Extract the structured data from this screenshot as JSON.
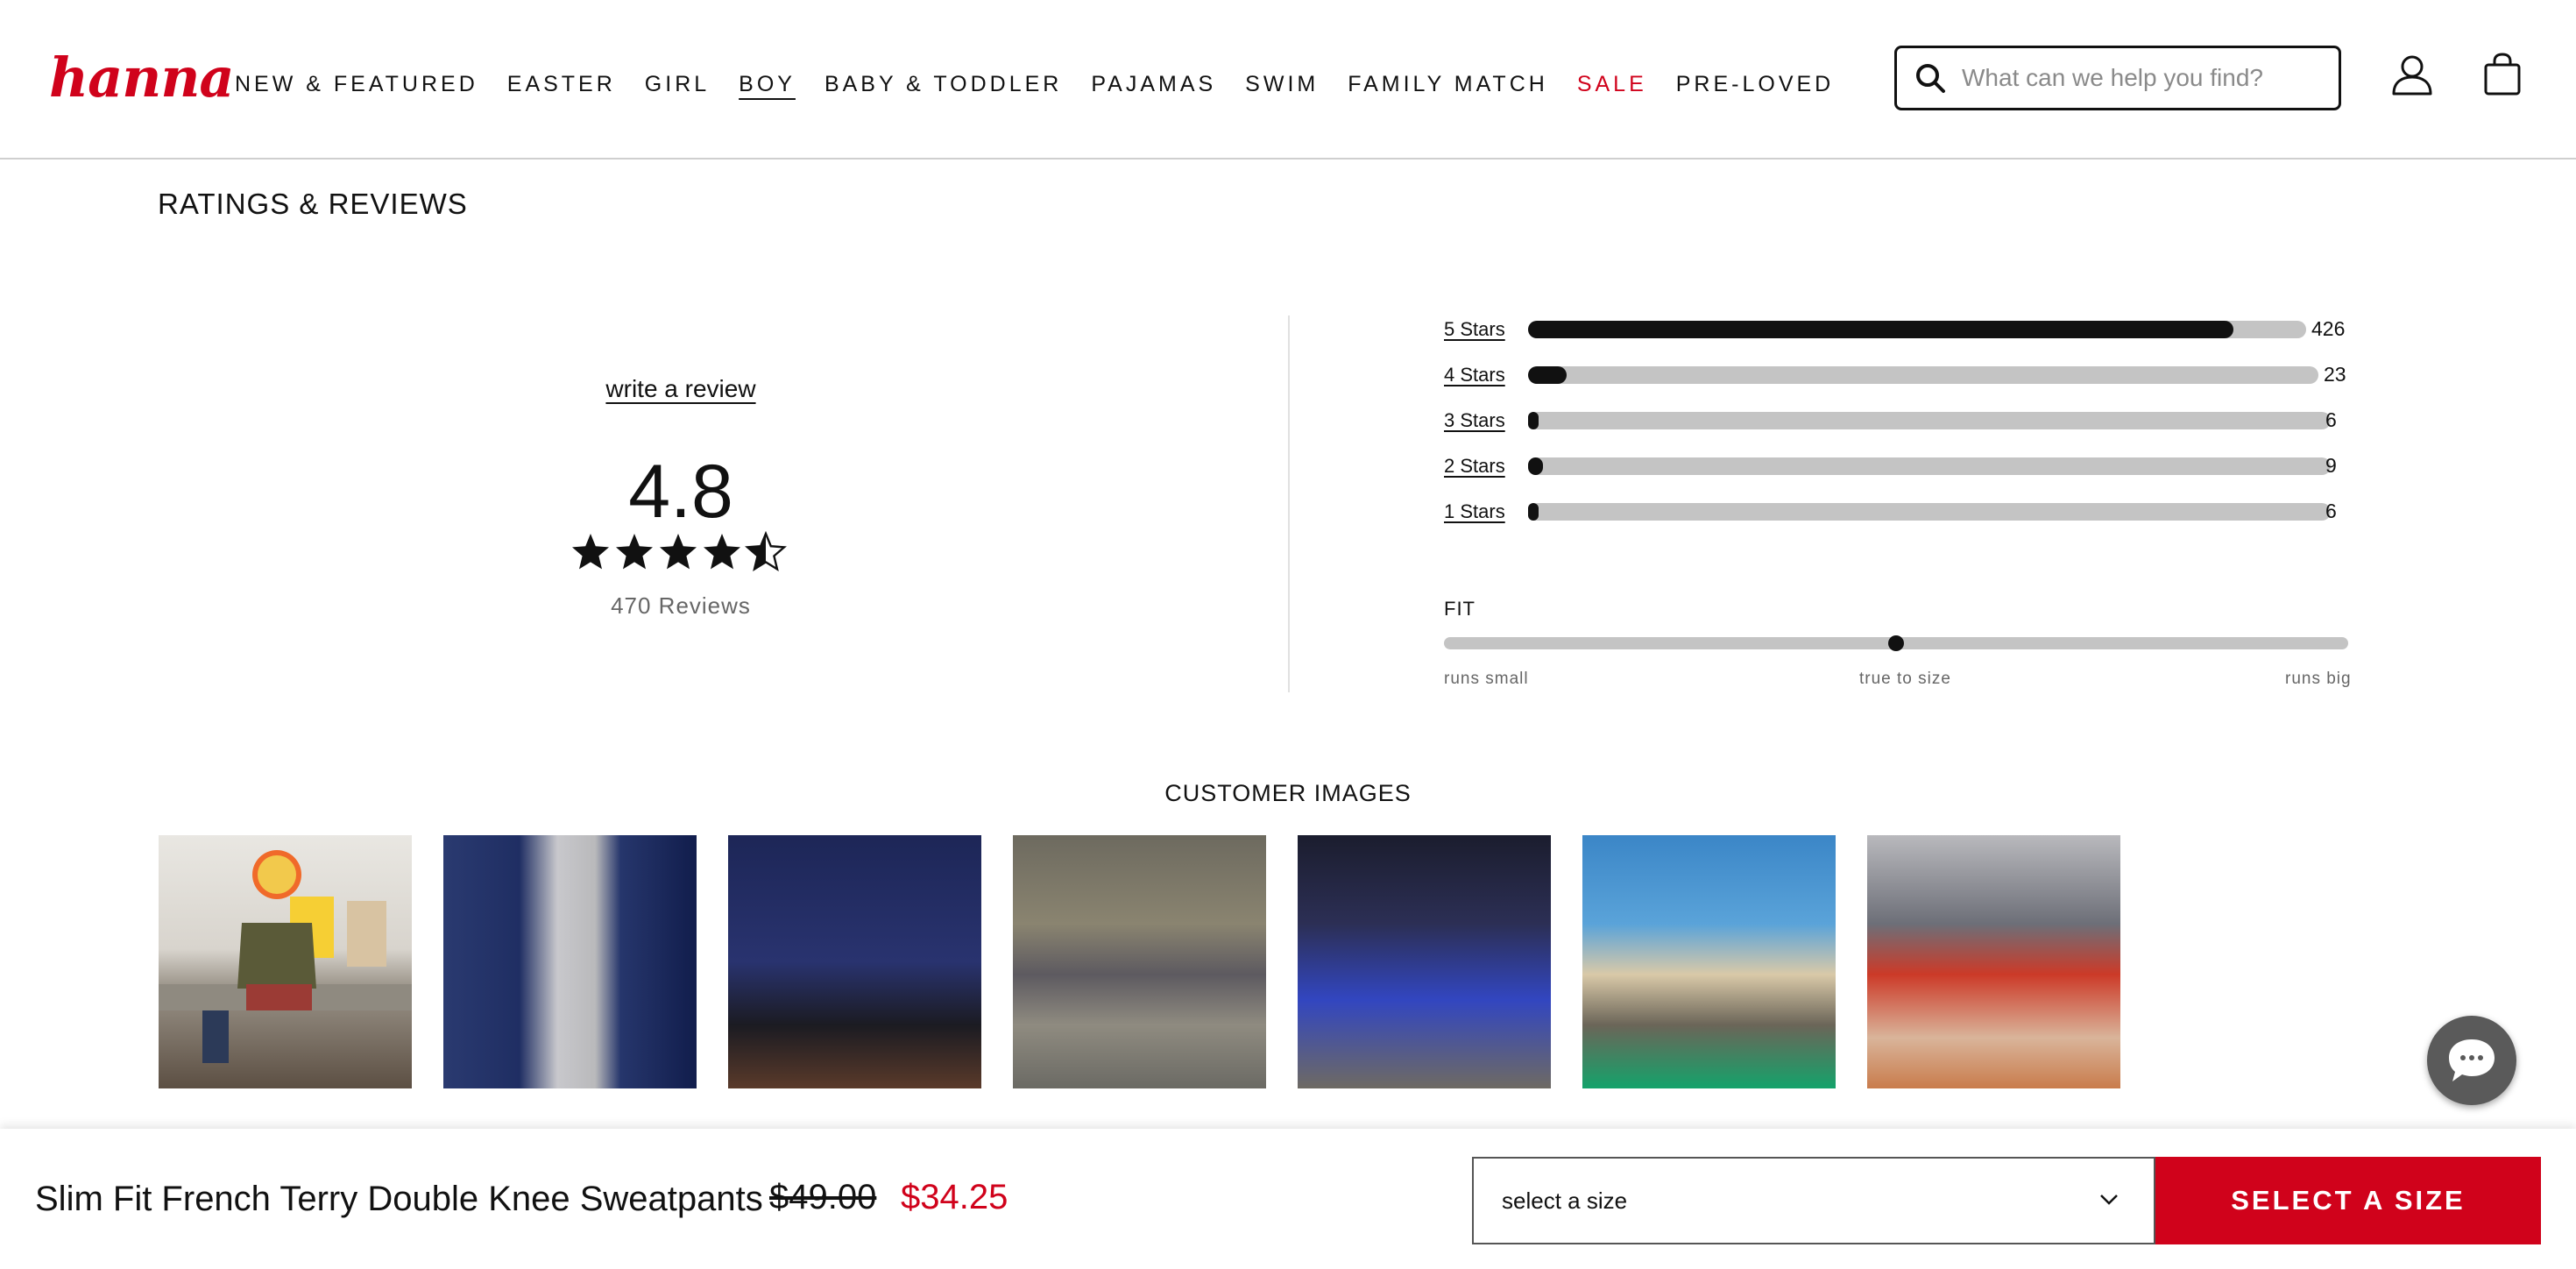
{
  "brand": {
    "logo_text": "hanna",
    "accent_color": "#d0021b"
  },
  "nav": {
    "items": [
      {
        "label": "NEW & FEATURED"
      },
      {
        "label": "EASTER"
      },
      {
        "label": "GIRL"
      },
      {
        "label": "BOY",
        "active": true
      },
      {
        "label": "BABY & TODDLER"
      },
      {
        "label": "PAJAMAS"
      },
      {
        "label": "SWIM"
      },
      {
        "label": "FAMILY MATCH"
      },
      {
        "label": "SALE",
        "highlight": true
      },
      {
        "label": "PRE-LOVED"
      }
    ]
  },
  "search": {
    "placeholder": "What can we help you find?",
    "icon": "search-icon"
  },
  "header_icons": [
    "account-icon",
    "shopping-bag-icon"
  ],
  "ratings": {
    "title": "RATINGS & REVIEWS",
    "write_review": "write a review",
    "average": "4.8",
    "average_value": 4.8,
    "review_count": "470 Reviews",
    "histogram": [
      {
        "label": "5 Stars",
        "count": "426",
        "fraction": 0.906
      },
      {
        "label": "4 Stars",
        "count": "23",
        "fraction": 0.049
      },
      {
        "label": "3 Stars",
        "count": "6",
        "fraction": 0.013
      },
      {
        "label": "2 Stars",
        "count": "9",
        "fraction": 0.019
      },
      {
        "label": "1 Stars",
        "count": "6",
        "fraction": 0.013
      }
    ],
    "fit": {
      "label": "FIT",
      "value": 0.5,
      "scale": [
        "runs small",
        "true to size",
        "runs big"
      ]
    }
  },
  "customer_images": {
    "title": "CUSTOMER IMAGES",
    "count": 7
  },
  "chat": {
    "icon": "chat-bubble-icon"
  },
  "sticky_bar": {
    "product_name": "Slim Fit French Terry Double Knee Sweatpants",
    "original_price": "$49.00",
    "sale_price": "$34.25",
    "size_select": "select a size",
    "cta": "SELECT A SIZE"
  }
}
